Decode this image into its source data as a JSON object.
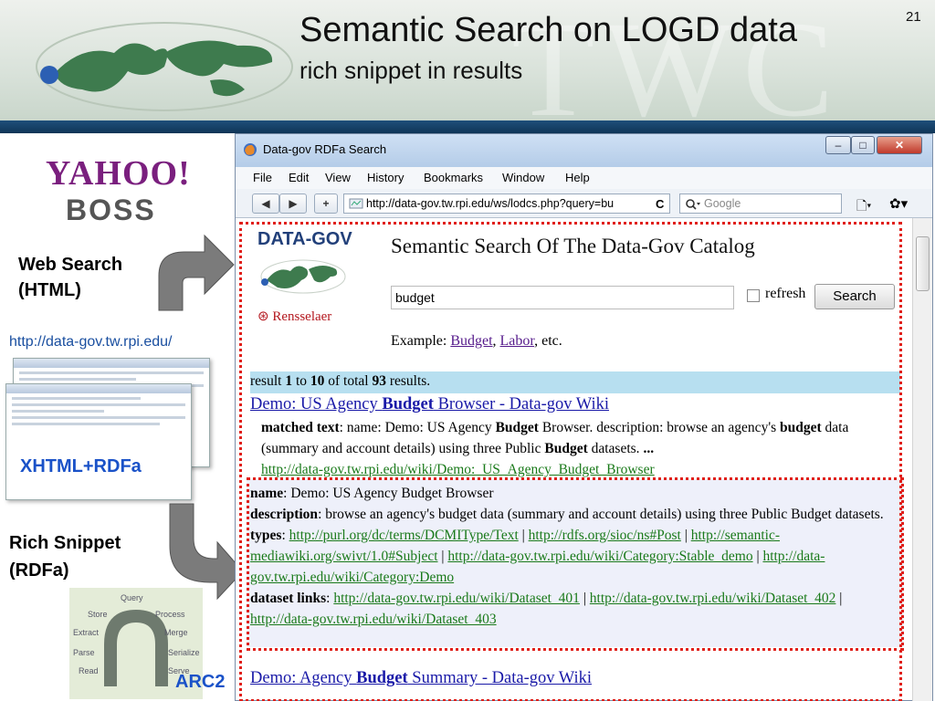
{
  "slide": {
    "title": "Semantic Search on LOGD data",
    "subtitle": "rich snippet in results",
    "number": "21",
    "watermark": "TWC"
  },
  "left": {
    "yahoo": "YAHOO!",
    "boss": "BOSS",
    "web_search_label_1": "Web Search",
    "web_search_label_2": "(HTML)",
    "url": "http://data-gov.tw.rpi.edu/",
    "xhtml_label": "XHTML+RDFa",
    "rich_label_1": "Rich Snippet",
    "rich_label_2": "(RDFa)",
    "arc_words": [
      "Query",
      "Store",
      "Process",
      "Extract",
      "Merge",
      "Parse",
      "Serialize",
      "Read",
      "Serve"
    ],
    "arc2": "ARC2"
  },
  "browser": {
    "window_title": "Data-gov RDFa Search",
    "window_buttons": [
      "–",
      "□",
      "✕"
    ],
    "menu": [
      "File",
      "Edit",
      "View",
      "History",
      "Bookmarks",
      "Window",
      "Help"
    ],
    "nav_back": "◀",
    "nav_forward": "▶",
    "nav_add": "+",
    "address": "http://data-gov.tw.rpi.edu/ws/lodcs.php?query=bu",
    "reload": "C",
    "search_placeholder": "Google",
    "page_icon": "🗋▾",
    "gear_icon": "✿▾"
  },
  "page": {
    "logo": "DATA-GOV",
    "rensselaer": "Rensselaer",
    "heading": "Semantic Search Of The Data-Gov Catalog",
    "query": "budget",
    "refresh_label": "refresh",
    "search_button": "Search",
    "example_prefix": "Example: ",
    "example_link_1": "Budget",
    "example_sep": ", ",
    "example_link_2": "Labor",
    "example_suffix": ", etc.",
    "result_summary": {
      "pre": "result ",
      "from": "1",
      "mid1": " to ",
      "to": "10",
      "mid2": " of total ",
      "total": "93",
      "post": " results."
    },
    "result1": {
      "title_a": "Demo: US Agency ",
      "title_b": "Budget",
      "title_c": " Browser - Data-gov Wiki",
      "matched_label": "matched text",
      "matched_a": ": name: Demo: US Agency ",
      "matched_b": "Budget",
      "matched_c": " Browser. description: browse an agency's ",
      "matched_d": "budget",
      "matched_e": " data (summary and account details) using three Public ",
      "matched_f": "Budget",
      "matched_g": " datasets. ",
      "matched_h": "...",
      "url": "http://data-gov.tw.rpi.edu/wiki/Demo:_US_Agency_Budget_Browser"
    },
    "snippet": {
      "name_label": "name",
      "name_value": ": Demo: US Agency Budget Browser",
      "desc_label": "description",
      "desc_value": ": browse an agency's budget data (summary and account details) using three Public Budget datasets.",
      "types_label": "types",
      "type1": "http://purl.org/dc/terms/DCMIType/Text",
      "type2": "http://rdfs.org/sioc/ns#Post",
      "type3": "http://semantic-mediawiki.org/swivt/1.0#Subject",
      "type4": "http://data-gov.tw.rpi.edu/wiki/Category:Stable_demo",
      "type5": "http://data-gov.tw.rpi.edu/wiki/Category:Demo",
      "sep": " | ",
      "links_label": "dataset links",
      "link1": "http://data-gov.tw.rpi.edu/wiki/Dataset_401",
      "link2": "http://data-gov.tw.rpi.edu/wiki/Dataset_402",
      "link3": "http://data-gov.tw.rpi.edu/wiki/Dataset_403"
    },
    "result2": {
      "title_a": "Demo: Agency ",
      "title_b": "Budget",
      "title_c": " Summary - Data-gov Wiki"
    }
  },
  "colors": {
    "header_bar": "#1f4f7a",
    "yahoo": "#7a1f7e",
    "label_blue": "#1a52c8",
    "result_bar": "#b7dff0",
    "snippet_bg": "#eef0fa",
    "dotted_border": "#e0201a",
    "link_green": "#1a7a1a"
  }
}
